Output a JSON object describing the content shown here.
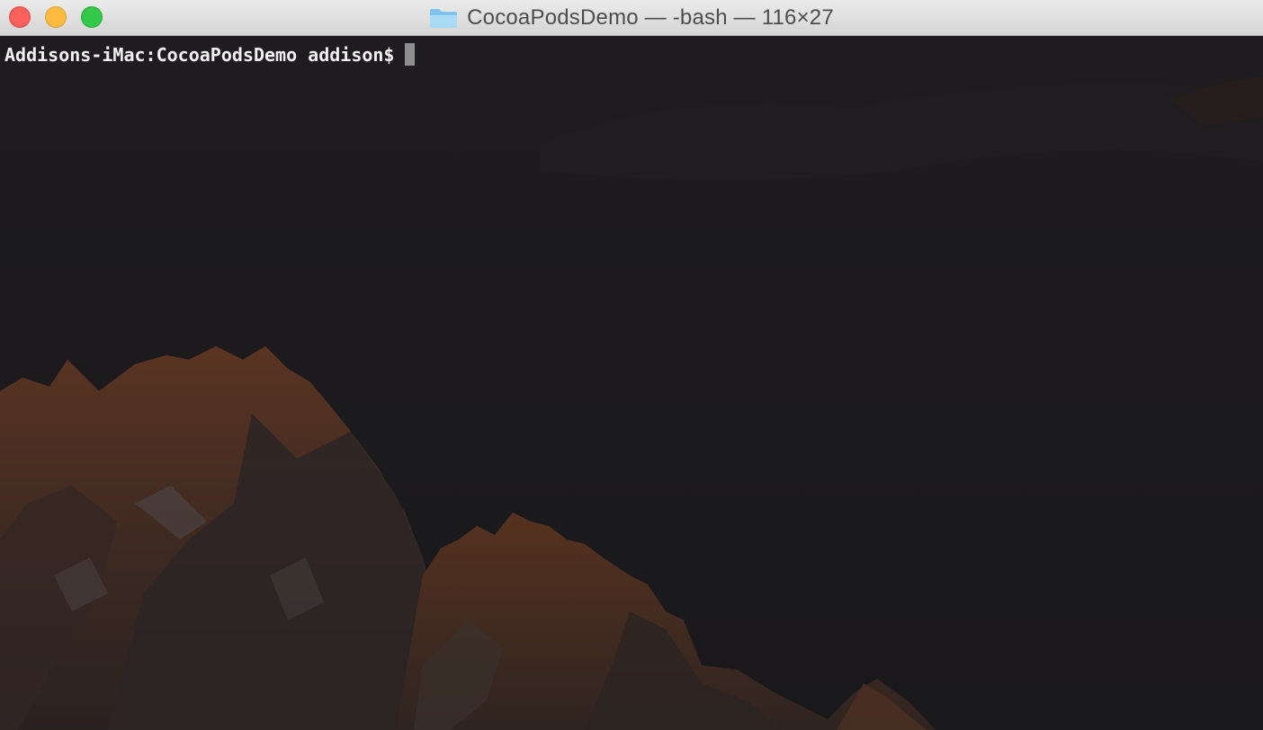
{
  "window": {
    "title": "CocoaPodsDemo — -bash — 116×27",
    "folder_icon": "folder-icon",
    "buttons": {
      "close": "close-button",
      "minimize": "minimize-button",
      "zoom": "zoom-button"
    }
  },
  "terminal": {
    "prompt": "Addisons-iMac:CocoaPodsDemo addison$",
    "input": "",
    "cursor": "block-cursor"
  },
  "colors": {
    "close": "#fc605c",
    "minimize": "#fdbc40",
    "zoom": "#34c84a",
    "terminal_bg": "#1b1a1c",
    "prompt_text": "#f2f2f2"
  }
}
